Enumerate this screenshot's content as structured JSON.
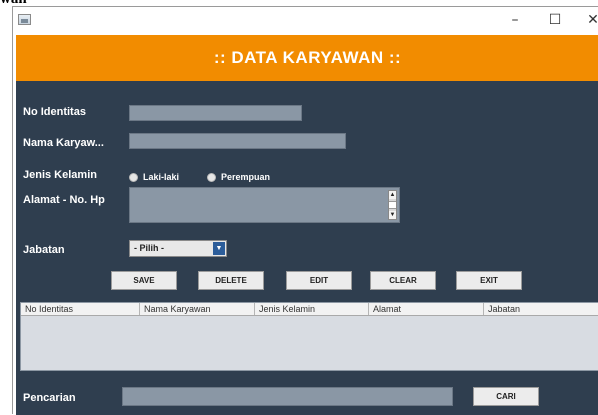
{
  "page_caption": "wan",
  "window": {
    "icon": "java-app-icon",
    "controls": {
      "minimize": "–",
      "maximize": "☐",
      "close": "✕"
    }
  },
  "header": {
    "title": ":: DATA KARYAWAN ::"
  },
  "form": {
    "no_identitas_label": "No Identitas",
    "nama_label": "Nama Karyaw...",
    "jenis_kelamin_label": "Jenis Kelamin",
    "gender_options": [
      "Laki-laki",
      "Perempuan"
    ],
    "alamat_label": "Alamat - No. Hp",
    "jabatan_label": "Jabatan",
    "jabatan_selected": "- Pilih -"
  },
  "buttons": {
    "save": "SAVE",
    "delete": "DELETE",
    "edit": "EDIT",
    "clear": "CLEAR",
    "exit": "EXIT"
  },
  "table": {
    "columns": [
      "No Identitas",
      "Nama Karyawan",
      "Jenis Kelamin",
      "Alamat",
      "Jabatan"
    ],
    "rows": []
  },
  "search": {
    "label": "Pencarian",
    "button": "CARI"
  },
  "colors": {
    "header": "#f28c00",
    "panel": "#2f3e4f",
    "field": "#8a97a5"
  }
}
